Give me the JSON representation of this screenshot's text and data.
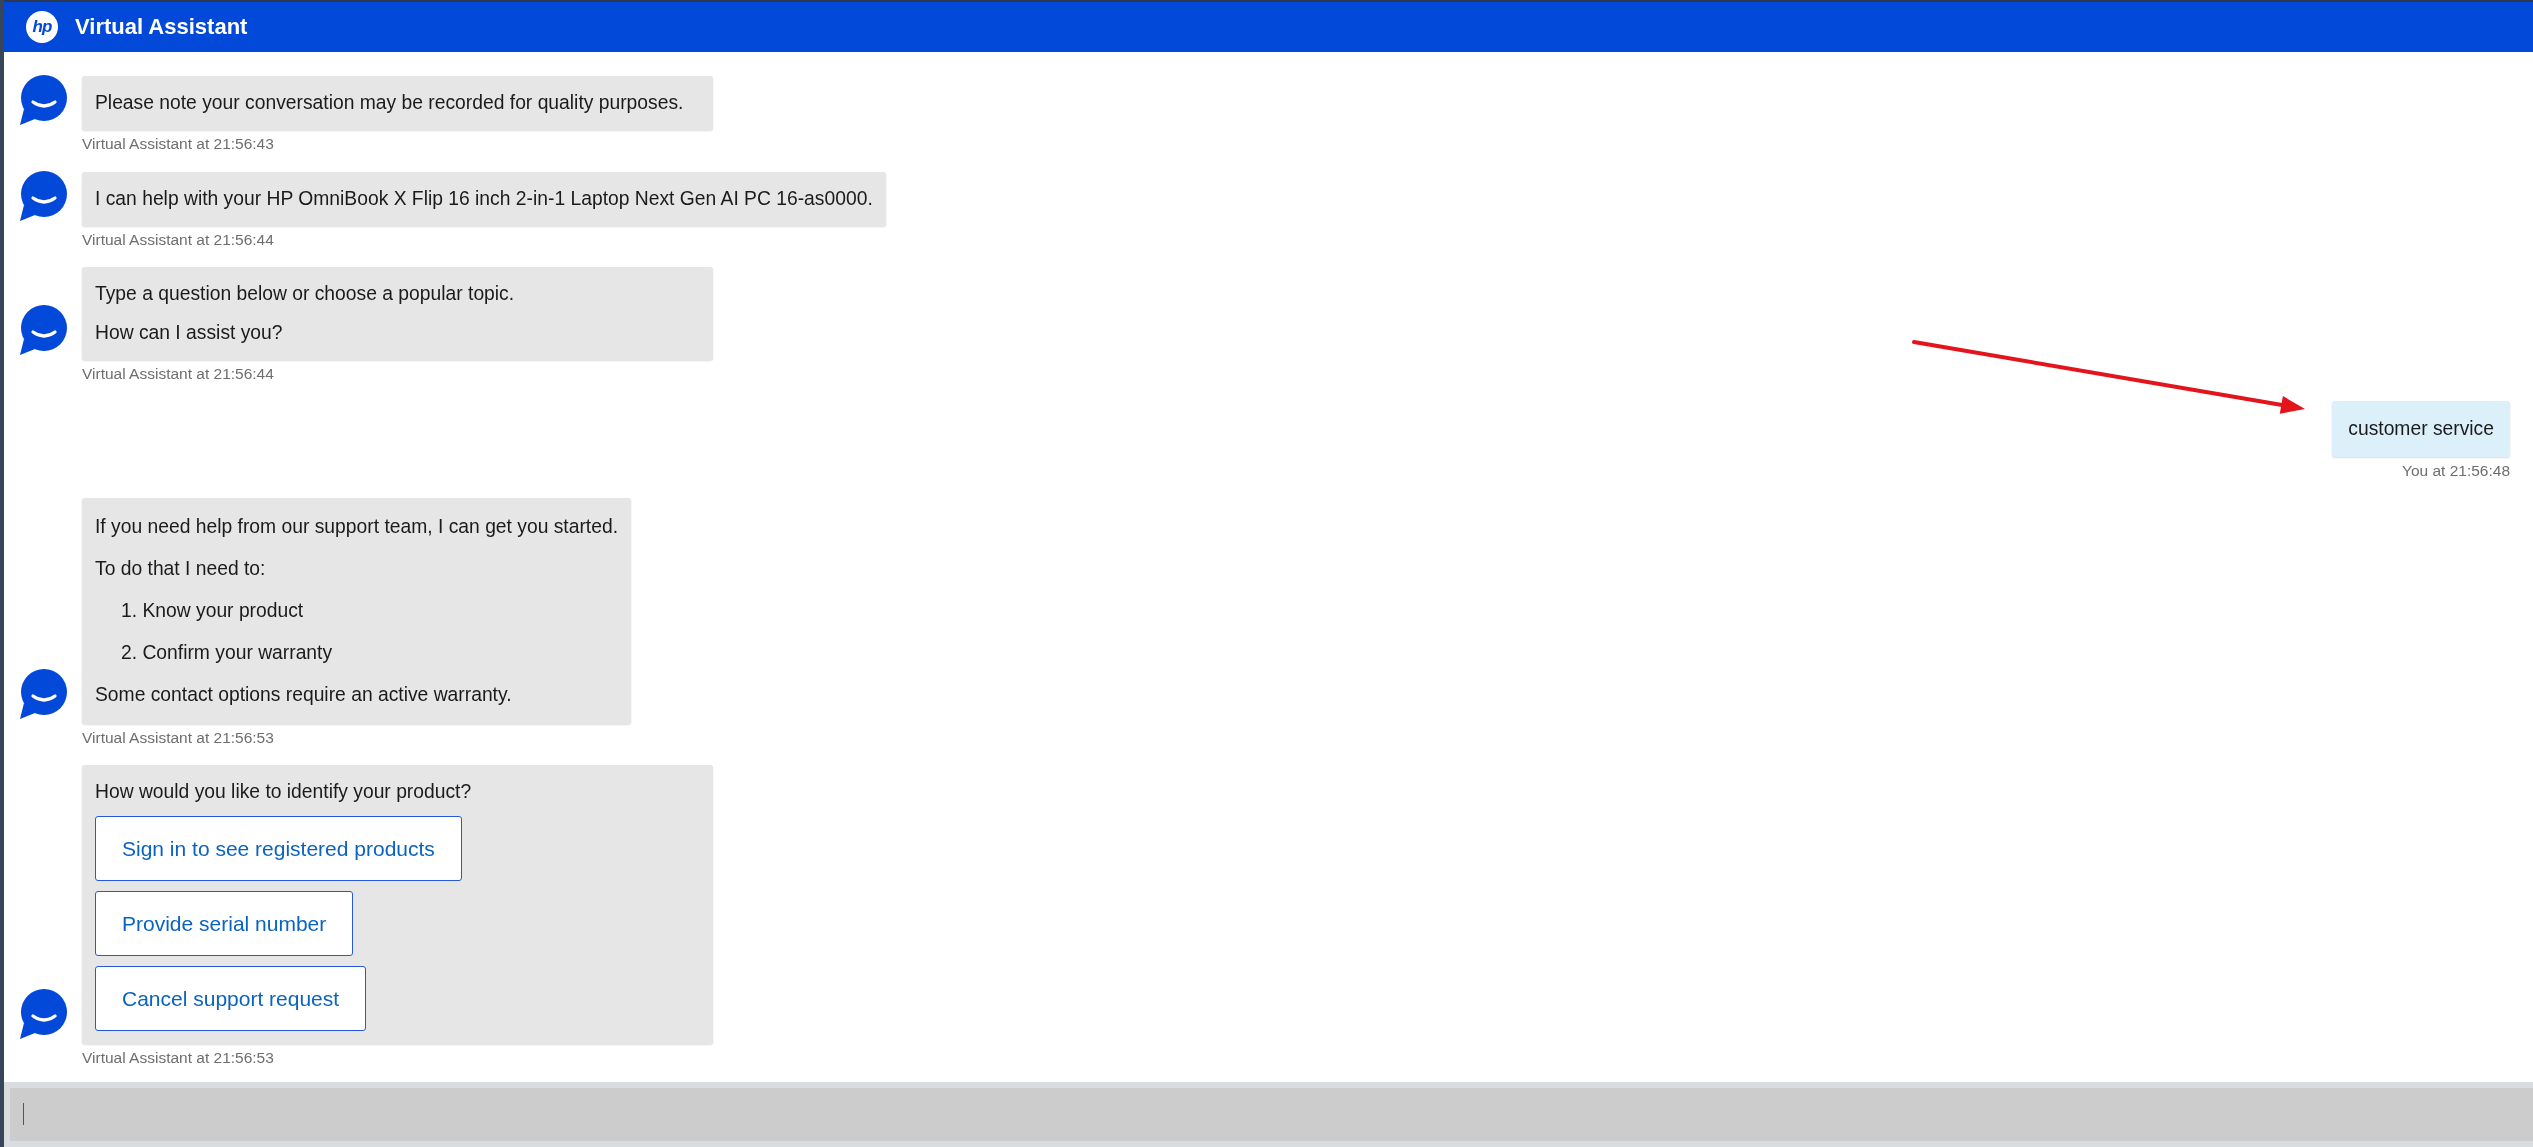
{
  "header": {
    "logo": "hp",
    "title": "Virtual Assistant"
  },
  "messages": [
    {
      "outgoing": false,
      "kind": "text",
      "paragraphs": [
        "Please note your conversation may be recorded for quality purposes."
      ],
      "timestamp": "Virtual Assistant at 21:56:43"
    },
    {
      "outgoing": false,
      "kind": "text",
      "paragraphs": [
        "I can help with your HP OmniBook X Flip 16 inch 2-in-1 Laptop Next Gen AI PC 16-as0000."
      ],
      "timestamp": "Virtual Assistant at 21:56:44"
    },
    {
      "outgoing": false,
      "kind": "text",
      "paragraphs": [
        "Type a question below or choose a popular topic.",
        "How can I assist you?"
      ],
      "timestamp": "Virtual Assistant at 21:56:44"
    },
    {
      "outgoing": true,
      "kind": "text",
      "paragraphs": [
        "customer service"
      ],
      "timestamp": "You at 21:56:48"
    },
    {
      "outgoing": false,
      "kind": "list",
      "paragraphs": [
        "If you need help from our support team, I can get you started.",
        "To do that I need to:"
      ],
      "items": [
        "1. Know your product",
        "2. Confirm your warranty"
      ],
      "closing": "Some contact options require an active warranty.",
      "timestamp": "Virtual Assistant at 21:56:53"
    },
    {
      "outgoing": false,
      "kind": "choices",
      "paragraphs": [
        "How would you like to identify your product?"
      ],
      "buttons": [
        "Sign in to see registered products",
        "Provide serial number",
        "Cancel support request"
      ],
      "timestamp": "Virtual Assistant at 21:56:53"
    }
  ],
  "composer": {
    "focused": true
  }
}
